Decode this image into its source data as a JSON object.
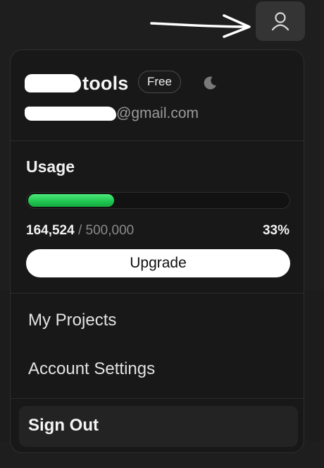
{
  "header": {
    "avatar_icon": "user-icon"
  },
  "account": {
    "brand_suffix": "tools",
    "plan_badge": "Free",
    "theme_icon": "moon-icon",
    "email_domain": "@gmail.com"
  },
  "usage": {
    "title": "Usage",
    "used": "164,524",
    "separator": " / ",
    "limit": "500,000",
    "percent_label": "33%",
    "fraction": 0.33,
    "bar_color": "#22c55e",
    "upgrade_label": "Upgrade"
  },
  "menu": {
    "items": [
      {
        "label": "My Projects"
      },
      {
        "label": "Account Settings"
      }
    ],
    "sign_out": "Sign Out"
  },
  "colors": {
    "page_bg": "#1e1e1e",
    "panel_bg": "#181818",
    "accent_green": "#22c55e"
  }
}
